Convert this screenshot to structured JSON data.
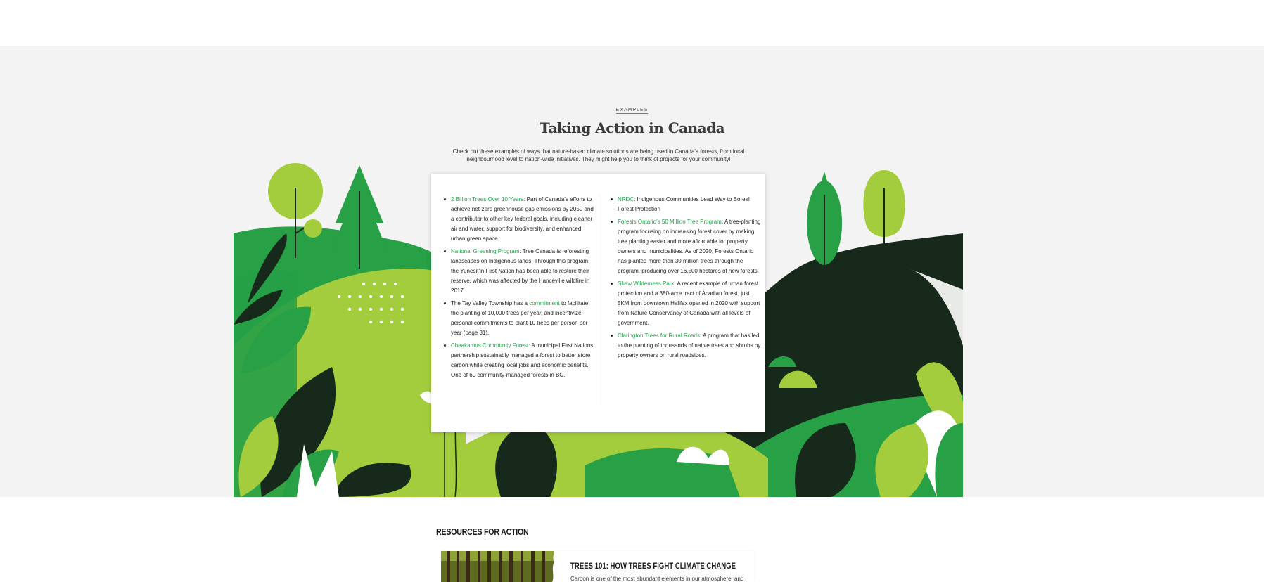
{
  "section": {
    "eyebrow": "EXAMPLES",
    "title": "Taking Action in Canada",
    "intro": "Check out these examples of ways that nature-based climate solutions are being used in Canada's forests, from local neighbourhood level to nation-wide initiatives. They might help you to think of projects for your community!"
  },
  "left_items": [
    {
      "link": "2 Billion Trees Over 10 Years",
      "text": ": Part of Canada's efforts to achieve net-zero greenhouse gas emissions by 2050 and a contributor to other key federal goals, including cleaner air and water, support for biodiversity, and enhanced urban green space."
    },
    {
      "link": "National Greening Program",
      "text": ": Tree Canada is reforesting landscapes on Indigenous lands. Through this program, the Yunesit'in First Nation has been able to restore their reserve, which was affected by the Hanceville wildfire in 2017."
    },
    {
      "pre": "The Tay Valley Township has a ",
      "link": "commitment",
      "text": " to facilitate the planting of 10,000 trees per year, and incentivize personal commitments to plant 10 trees per person per year (page 31)."
    },
    {
      "link": "Cheakamus Community Forest",
      "text": ": A municipal First Nations partnership sustainably managed a forest to better store carbon while creating local jobs and economic benefits. One of 60 community-managed forests in BC."
    }
  ],
  "right_items": [
    {
      "link": "NRDC",
      "text": ": Indigenous Communities Lead Way to Boreal Forest Protection"
    },
    {
      "link": "Forests Ontario's 50 Million Tree Program",
      "text": ": A tree-planting program focusing on increasing forest cover by making tree planting easier and more affordable for property owners and municipalities. As of 2020, Forests Ontario has planted more than 30 million trees through the program, producing over 16,500 hectares of new forests."
    },
    {
      "link": "Shaw Wilderness Park",
      "text": ": A recent example of urban forest protection and a 380-acre tract of Acadian forest, just 5KM from downtown Halifax opened in 2020 with support from Nature Conservancy of Canada with all levels of government."
    },
    {
      "link": "Clarington Trees for Rural Roads",
      "text": ": A program that has led to the planting of thousands of native trees and shrubs by property owners on rural roadsides."
    }
  ],
  "resources": {
    "title": "RESOURCES FOR ACTION",
    "card_title": "TREES 101: HOW TREES FIGHT CLIMATE CHANGE",
    "card_desc": "Carbon is one of the most abundant elements in our atmosphere, and"
  },
  "colors": {
    "dark_green": "#16291a",
    "green": "#27a046",
    "light_green": "#a3cd3c",
    "link": "#1fa24a"
  }
}
